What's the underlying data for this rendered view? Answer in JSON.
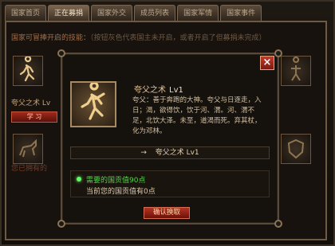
{
  "tabs": [
    {
      "label": "国家首页"
    },
    {
      "label": "正在募捐"
    },
    {
      "label": "国家外交"
    },
    {
      "label": "成员列表"
    },
    {
      "label": "国家军情"
    },
    {
      "label": "国家事件"
    }
  ],
  "notice": {
    "title": "国家可冒捧开启的技能：",
    "hint": "（按钮灰色代表国主未开启，或者开启了但募捐未完成）"
  },
  "skill_cell_label": "夸父之术 Lv",
  "learn_button": "学 习",
  "have_label": "您已拥有的",
  "popup": {
    "skill_name": "夸父之术",
    "skill_level": "Lv1",
    "description": "夸父：善于奔跑的大神。夸父与日逐走，入日；渴，欲得饮，饮于河、渭。河、渭不足，北饮大泽。未至，道渴而死。弃其杖，化为邓林。",
    "next_level_arrow": "→",
    "next_level_text": "夸父之术 Lv1",
    "requirement": "需要的国贡值90点",
    "current": "当前您的国贡值有0点",
    "confirm_button": "确认换取",
    "close_label": "×"
  }
}
